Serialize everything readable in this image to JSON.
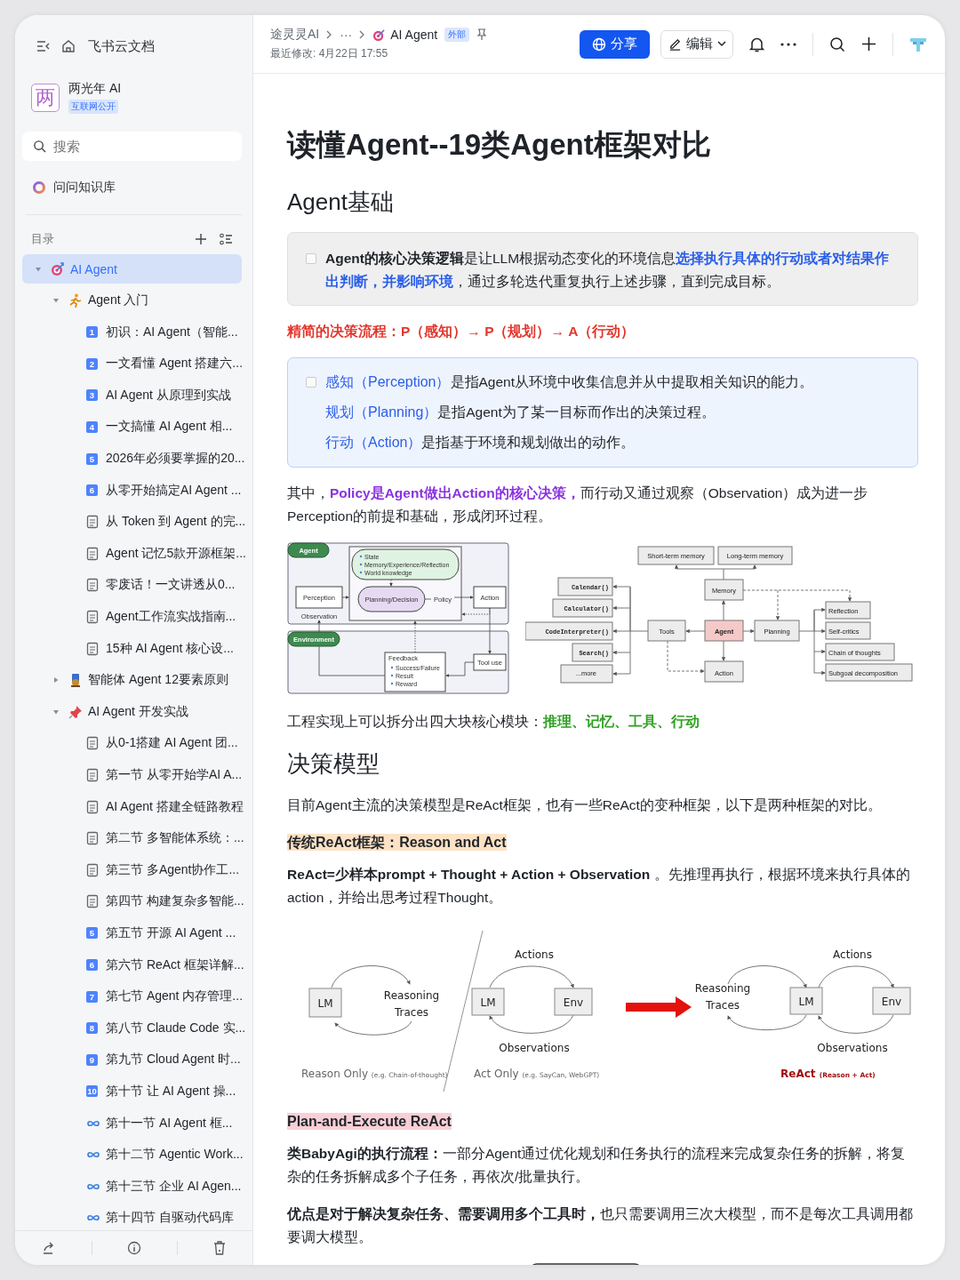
{
  "sidebar": {
    "nav_title": "飞书云文档",
    "space": {
      "avatar": "两",
      "name": "两光年 AI",
      "badge": "互联网公开"
    },
    "search": {
      "placeholder": "搜索"
    },
    "ask": "问问知识库",
    "toc_label": "目录",
    "tree": [
      {
        "label": "AI Agent",
        "kind": "target",
        "selected": true,
        "expanded": true,
        "children": [
          {
            "label": "Agent 入门",
            "kind": "runner",
            "selected": false,
            "expanded": true,
            "children": [
              {
                "label": "初识：AI Agent（智能...",
                "kind": "number",
                "number": "1",
                "selected": false
              },
              {
                "label": "一文看懂 Agent 搭建六...",
                "kind": "number",
                "number": "2",
                "selected": false
              },
              {
                "label": "AI Agent 从原理到实战",
                "kind": "number",
                "number": "3",
                "selected": false
              },
              {
                "label": "一文搞懂 AI Agent 相...",
                "kind": "number",
                "number": "4",
                "selected": false
              },
              {
                "label": "2026年必须要掌握的20...",
                "kind": "number",
                "number": "5",
                "selected": false
              },
              {
                "label": "从零开始搞定AI Agent ...",
                "kind": "number",
                "number": "6",
                "selected": false
              },
              {
                "label": "从 Token 到 Agent 的完...",
                "kind": "doc",
                "selected": false
              },
              {
                "label": "Agent 记忆5款开源框架...",
                "kind": "doc",
                "selected": false
              },
              {
                "label": "零废话！一文讲透从0...",
                "kind": "doc",
                "selected": false
              },
              {
                "label": "Agent工作流实战指南...",
                "kind": "doc",
                "selected": false
              },
              {
                "label": "15种 AI Agent 核心设...",
                "kind": "doc",
                "selected": false
              }
            ]
          },
          {
            "label": "智能体 Agent 12要素原则",
            "kind": "award",
            "selected": false,
            "expanded": false
          },
          {
            "label": "AI Agent 开发实战",
            "kind": "pin",
            "selected": false,
            "expanded": true,
            "children": [
              {
                "label": "从0-1搭建 AI Agent 团...",
                "kind": "doc",
                "selected": false
              },
              {
                "label": "第一节 从零开始学AI A...",
                "kind": "doc",
                "selected": false
              },
              {
                "label": "AI Agent 搭建全链路教程",
                "kind": "doc",
                "selected": false
              },
              {
                "label": "第二节 多智能体系统：...",
                "kind": "doc",
                "selected": false
              },
              {
                "label": "第三节 多Agent协作工...",
                "kind": "doc",
                "selected": false
              },
              {
                "label": "第四节 构建复杂多智能...",
                "kind": "doc",
                "selected": false
              },
              {
                "label": "第五节 开源 AI Agent ...",
                "kind": "number",
                "number": "5",
                "selected": false
              },
              {
                "label": "第六节 ReAct 框架详解...",
                "kind": "number",
                "number": "6",
                "selected": false
              },
              {
                "label": "第七节 Agent 内存管理...",
                "kind": "number",
                "number": "7",
                "selected": false
              },
              {
                "label": "第八节 Claude Code 实...",
                "kind": "number",
                "number": "8",
                "selected": false
              },
              {
                "label": "第九节 Cloud Agent 时...",
                "kind": "number",
                "number": "9",
                "selected": false
              },
              {
                "label": "第十节 让 AI Agent 操...",
                "kind": "number",
                "number": "10",
                "selected": false
              },
              {
                "label": "第十一节 AI Agent 框...",
                "kind": "link",
                "selected": false
              },
              {
                "label": "第十二节 Agentic Work...",
                "kind": "link",
                "selected": false
              },
              {
                "label": "第十三节 企业 AI Agen...",
                "kind": "link",
                "selected": false
              },
              {
                "label": "第十四节 自驱动代码库",
                "kind": "link",
                "selected": false
              }
            ]
          }
        ]
      }
    ]
  },
  "header": {
    "breadcrumb": [
      "途灵灵AI",
      "···",
      "AI Agent"
    ],
    "badge": "外部",
    "modified": "最近修改: 4月22日 17:55",
    "share": "分享",
    "edit": "编辑"
  },
  "document": {
    "title": "读懂Agent--19类Agent框架对比",
    "blocks": [
      {
        "kind": "h2",
        "text": "Agent基础"
      },
      {
        "kind": "callout",
        "lines": [
          [
            {
              "text": "Agent的核心决策逻辑",
              "kind": "term"
            },
            {
              "text": "是让LLM根据动态变化的环境信息",
              "kind": "plain"
            },
            {
              "text": "选择执行具体的行动或者对结果作出判断，并影响环境",
              "kind": "key"
            },
            {
              "text": "，通过多轮迭代重复执行上述步骤，直到完成目标。",
              "kind": "plain"
            }
          ]
        ]
      },
      {
        "kind": "para",
        "segments": [
          {
            "text": "精简的决策流程：P（感知）→ P（规划）→ A（行动）",
            "kind": "flow"
          }
        ]
      },
      {
        "kind": "info",
        "lines": [
          [
            {
              "text": "感知（Perception）",
              "kind": "concept"
            },
            {
              "text": "是指Agent从环境中收集信息并从中提取相关知识的能力。",
              "kind": "plain"
            }
          ],
          [
            {
              "text": "规划（Planning）",
              "kind": "concept"
            },
            {
              "text": "是指Agent为了某一目标而作出的决策过程。",
              "kind": "plain"
            }
          ],
          [
            {
              "text": "行动（Action）",
              "kind": "concept"
            },
            {
              "text": "是指基于环境和规划做出的动作。",
              "kind": "plain"
            }
          ]
        ]
      },
      {
        "kind": "para",
        "segments": [
          {
            "text": "其中，",
            "kind": "plain"
          },
          {
            "text": "Policy是Agent做出Action的核心决策，",
            "kind": "policy"
          },
          {
            "text": "而行动又通过观察（Observation）成为进一步Perception的前提和基础，形成闭环过程。",
            "kind": "plain"
          }
        ]
      },
      {
        "kind": "agent-figures",
        "loop": {
          "agent": "Agent",
          "state": [
            "State",
            "Memory/Experience/Reflection",
            "World knowledge"
          ],
          "perception": "Perception",
          "planning": "Planning/Decision",
          "policy": "Policy",
          "action": "Action",
          "observation": "Observation",
          "environment": "Environment",
          "feedback": "Feedback",
          "tool_use": "Tool use",
          "feedback_items": [
            "Success/Failure",
            "Result",
            "Reward"
          ]
        },
        "modules": {
          "short_term": "Short-term memory",
          "long_term": "Long-term memory",
          "memory": "Memory",
          "tools_list": [
            "Calendar()",
            "Calculator()",
            "CodeInterpreter()",
            "Search()",
            "...more"
          ],
          "tools": "Tools",
          "agent": "Agent",
          "planning": "Planning",
          "action": "Action",
          "planning_list": [
            "Reflection",
            "Self-critics",
            "Chain of thoughts",
            "Subgoal decomposition"
          ]
        }
      },
      {
        "kind": "para",
        "segments": [
          {
            "text": "工程实现上可以拆分出四大块核心模块：",
            "kind": "plain"
          },
          {
            "text": "推理、记忆、工具、行动",
            "kind": "modules"
          }
        ]
      },
      {
        "kind": "h2",
        "text": "决策模型"
      },
      {
        "kind": "para",
        "segments": [
          {
            "text": "目前Agent主流的决策模型是ReAct框架，也有一些ReAct的变种框架，以下是两种框架的对比。",
            "kind": "plain"
          }
        ]
      },
      {
        "kind": "highlight",
        "color": "#fde2c5",
        "text": "传统ReAct框架：Reason and Act"
      },
      {
        "kind": "para",
        "segments": [
          {
            "text": "ReAct=少样本prompt + Thought + Action + Observation",
            "kind": "term"
          },
          {
            "text": " 。先推理再执行，根据环境来执行具体的action，并给出思考过程Thought。",
            "kind": "plain"
          }
        ]
      },
      {
        "kind": "react-figure",
        "reason_only": {
          "lm": "LM",
          "traces": [
            "Reasoning",
            "Traces"
          ],
          "caption": "Reason Only",
          "note": "(e.g. Chain-of-thought)"
        },
        "act_only": {
          "lm": "LM",
          "env": "Env",
          "actions": "Actions",
          "observations": "Observations",
          "caption": "Act Only",
          "note": "(e.g. SayCan, WebGPT)"
        },
        "react": {
          "traces": [
            "Reasoning",
            "Traces"
          ],
          "lm": "LM",
          "env": "Env",
          "actions": "Actions",
          "observations": "Observations",
          "caption": "ReAct",
          "note": "(Reason + Act)"
        }
      },
      {
        "kind": "highlight",
        "color": "#f8cfd6",
        "text": "Plan-and-Execute ReAct"
      },
      {
        "kind": "para",
        "segments": [
          {
            "text": "类BabyAgi的执行流程：",
            "kind": "term"
          },
          {
            "text": "一部分Agent通过优化规划和任务执行的流程来完成复杂任务的拆解，将复杂的任务拆解成多个子任务，再依次/批量执行。",
            "kind": "plain"
          }
        ]
      },
      {
        "kind": "para",
        "segments": [
          {
            "text": "优点是对于解决复杂任务、需要调用多个工具时，",
            "kind": "term"
          },
          {
            "text": "也只需要调用三次大模型，而不是每次工具调用都要调大模型。",
            "kind": "plain"
          }
        ]
      }
    ]
  }
}
